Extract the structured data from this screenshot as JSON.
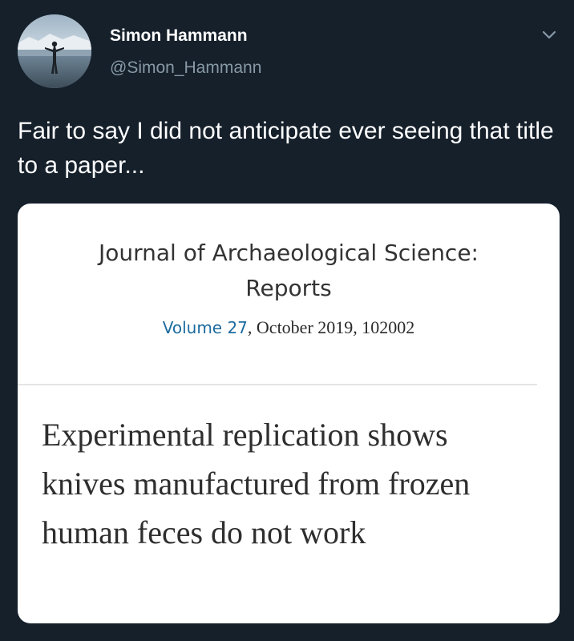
{
  "tweet": {
    "author": {
      "display_name": "Simon Hammann",
      "handle": "@Simon_Hammann"
    },
    "icons": {
      "avatar": "profile-photo",
      "menu": "chevron-down-icon"
    },
    "colors": {
      "background": "#15202b",
      "handle": "#8899a6",
      "link": "#1c6b9e"
    },
    "text": "Fair to say I did not anticipate ever seeing that title to a paper..."
  },
  "card": {
    "journal_name": "Journal of Archaeological Science: Reports",
    "volume_link": "Volume 27",
    "volume_rest": ", October 2019, 102002",
    "article_title": "Experimental replication shows knives manufactured from frozen human feces do not work"
  }
}
